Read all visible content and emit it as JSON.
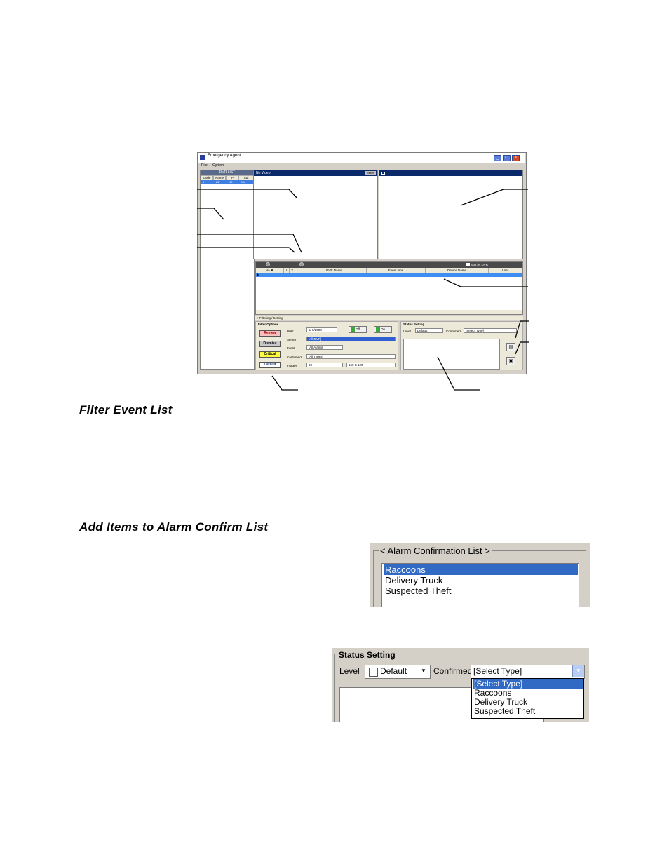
{
  "window": {
    "title": "Emergency Agent",
    "menu": [
      "File",
      "Option"
    ],
    "dvr_list": {
      "title": "DVR LIST",
      "columns": [
        "Code",
        "Name",
        "IP",
        "Sta"
      ],
      "selected_row": [
        "1",
        "DE",
        "10",
        "Wa"
      ]
    },
    "video_panel": {
      "title": "No Video",
      "button": "Reset"
    },
    "event_list": {
      "sort_label": "Sort by DVR",
      "columns": [
        "No ▼",
        "!",
        "?",
        "",
        "DVR Name",
        "Event time",
        "Device Name",
        "User"
      ]
    },
    "settings_tab": "+ Filtering / Setting",
    "filter_options": {
      "title": "Filter Options",
      "levels": [
        {
          "label": "Review",
          "color": "#f7c0c0"
        },
        {
          "label": "Dismiss",
          "color": "#c8c8c8"
        },
        {
          "label": "Critical",
          "color": "#ffff40"
        },
        {
          "label": "Default",
          "color": "#ffffff"
        }
      ],
      "fields": {
        "date_label": "Date",
        "date_value": "5/ 5/2008",
        "server_label": "Server",
        "server_value": "[All DVR]",
        "event_label": "Event",
        "event_value": "[All Alarm]",
        "confirmed_label": "Confirmed",
        "confirmed_value": "[All Types]",
        "images_label": "Images",
        "images_value": "20",
        "size_value": "160 X 120"
      },
      "off_label": "Off",
      "on_label": "On"
    },
    "status_setting": {
      "title": "Status Setting",
      "level_label": "Level",
      "level_value": "Default",
      "confirmed_label": "Confirmed",
      "confirmed_value": "[Select Type]"
    }
  },
  "headings": {
    "filter": "Filter Event List",
    "add_items": "Add Items to Alarm Confirm List"
  },
  "alarm_confirmation_list": {
    "legend": "< Alarm Confirmation List >",
    "items": [
      "Raccoons",
      "Delivery Truck",
      "Suspected Theft"
    ]
  },
  "status_setting_detail": {
    "title": "Status Setting",
    "level_label": "Level",
    "level_value": "Default",
    "confirmed_label": "Confirmed",
    "confirmed_value": "[Select Type]",
    "options": [
      "[Select Type]",
      "Raccoons",
      "Delivery Truck",
      "Suspected Theft"
    ]
  }
}
